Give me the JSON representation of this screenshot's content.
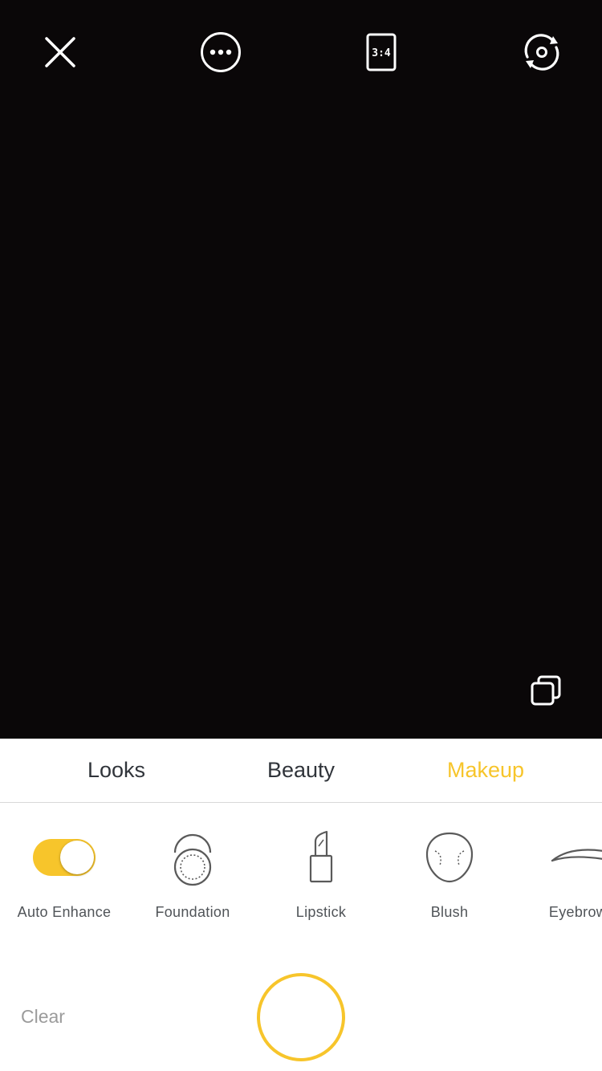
{
  "top_bar": {
    "close_icon": "close-icon",
    "more_icon": "more-icon",
    "aspect_ratio": "3:4",
    "switch_camera_icon": "switch-camera-icon"
  },
  "viewfinder": {
    "background": "#0a0708",
    "gallery_icon": "gallery-icon"
  },
  "tabs": [
    {
      "label": "Looks",
      "active": false
    },
    {
      "label": "Beauty",
      "active": false
    },
    {
      "label": "Makeup",
      "active": true
    }
  ],
  "tools": [
    {
      "label": "Auto Enhance",
      "icon": "toggle",
      "enabled": true
    },
    {
      "label": "Foundation",
      "icon": "foundation-icon"
    },
    {
      "label": "Lipstick",
      "icon": "lipstick-icon"
    },
    {
      "label": "Blush",
      "icon": "blush-icon"
    },
    {
      "label": "Eyebrow",
      "icon": "eyebrow-icon"
    }
  ],
  "bottom": {
    "clear_label": "Clear",
    "shutter_icon": "shutter-button"
  },
  "colors": {
    "accent": "#f7c52b",
    "tab_text": "#30343a",
    "label_text": "#505458",
    "clear_text": "#9b9b9b"
  }
}
